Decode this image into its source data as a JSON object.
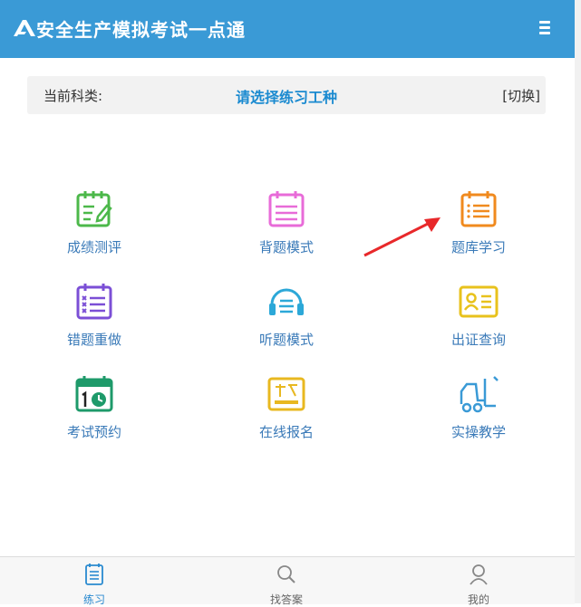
{
  "header": {
    "title": "安全生产模拟考试一点通",
    "logo_icon": "brand-logo-icon",
    "menu_icon": "hamburger-menu-icon",
    "bg_color": "#3a9ad6"
  },
  "subject": {
    "label": "当前科类:",
    "value": "请选择练习工种",
    "switch_label": "[切换]",
    "value_color": "#1a8ad0"
  },
  "grid": [
    {
      "label": "成绩测评",
      "icon": "score-evaluation-icon",
      "color": "#4cb84a"
    },
    {
      "label": "背题模式",
      "icon": "recite-questions-icon",
      "color": "#e86bd8"
    },
    {
      "label": "题库学习",
      "icon": "question-bank-icon",
      "color": "#f08a1e"
    },
    {
      "label": "错题重做",
      "icon": "wrong-questions-icon",
      "color": "#7b4fd6"
    },
    {
      "label": "听题模式",
      "icon": "listen-mode-icon",
      "color": "#2ca8d8"
    },
    {
      "label": "出证查询",
      "icon": "certificate-query-icon",
      "color": "#e8c21c"
    },
    {
      "label": "考试预约",
      "icon": "exam-booking-icon",
      "color": "#1e9a6a"
    },
    {
      "label": "在线报名",
      "icon": "online-registration-icon",
      "color": "#e8b820"
    },
    {
      "label": "实操教学",
      "icon": "practical-teaching-icon",
      "color": "#3a9ad6"
    }
  ],
  "annotation": {
    "icon": "red-arrow-icon",
    "color": "#e8282a"
  },
  "tabbar": {
    "tabs": [
      {
        "label": "练习",
        "icon": "practice-icon",
        "active": true
      },
      {
        "label": "找答案",
        "icon": "search-icon",
        "active": false
      },
      {
        "label": "我的",
        "icon": "user-icon",
        "active": false
      }
    ],
    "active_color": "#2a8ad0"
  }
}
